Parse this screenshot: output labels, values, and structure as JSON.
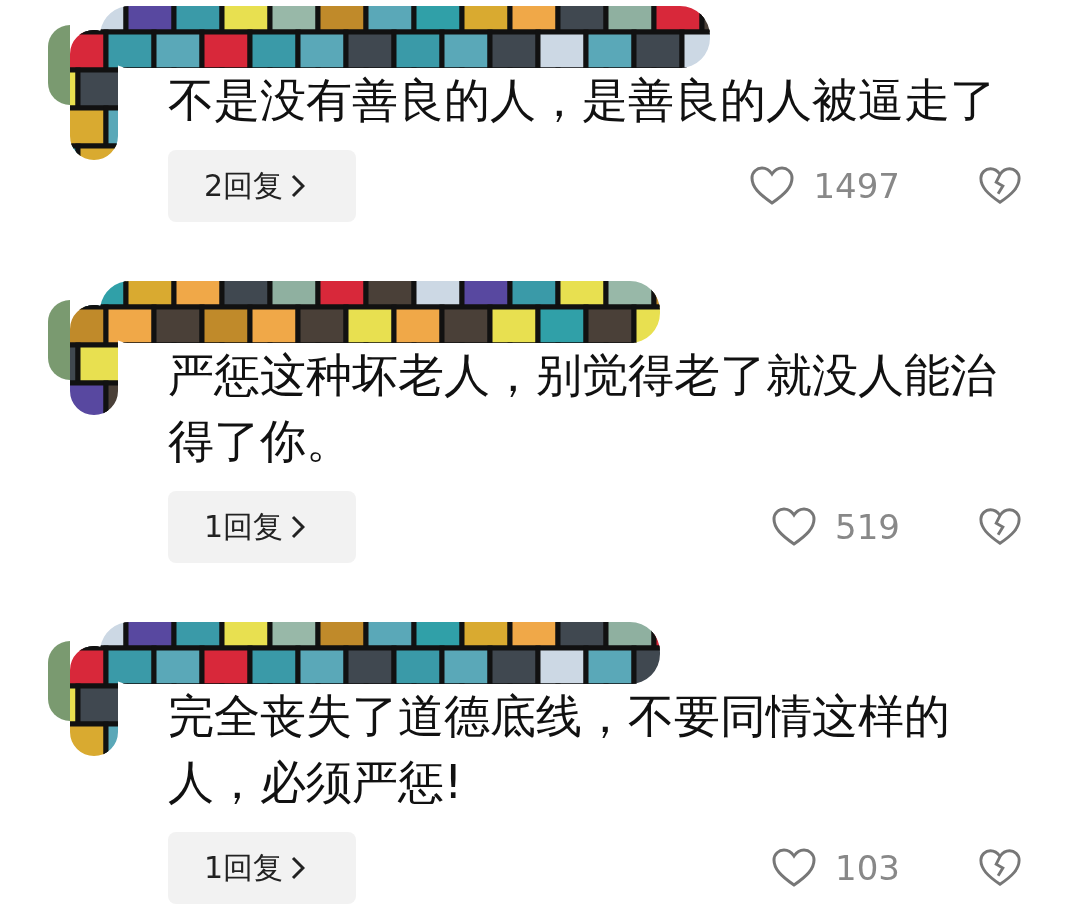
{
  "comments": [
    {
      "text": "不是没有善良的人，是善良的人被逼走了",
      "replies": "2回复",
      "likes": "1497"
    },
    {
      "text": "严惩这种坏老人，别觉得老了就没人能治得了你。",
      "replies": "1回复",
      "likes": "519"
    },
    {
      "text": "完全丧失了道德底线，不要同情这样的人，必须严惩!",
      "replies": "1回复",
      "likes": "103"
    }
  ]
}
